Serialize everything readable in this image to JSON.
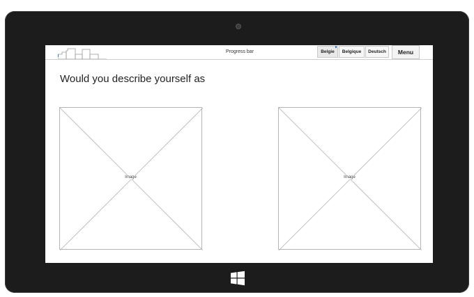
{
  "header": {
    "progress_label": "Progress bar",
    "languages": [
      {
        "label": "Belgie",
        "active": true
      },
      {
        "label": "Belgique",
        "active": false
      },
      {
        "label": "Deutsch",
        "active": false
      }
    ],
    "menu_label": "Menu"
  },
  "question": {
    "text": "Would you describe yourself as"
  },
  "options": [
    {
      "image_label": "Image"
    },
    {
      "image_label": "Image"
    }
  ],
  "icons": {
    "logo": "city-skyline-logo",
    "windows": "windows-logo-icon",
    "camera": "camera-icon"
  },
  "colors": {
    "device_bezel": "#1c1c1c",
    "accent": "#3a7bd5"
  }
}
